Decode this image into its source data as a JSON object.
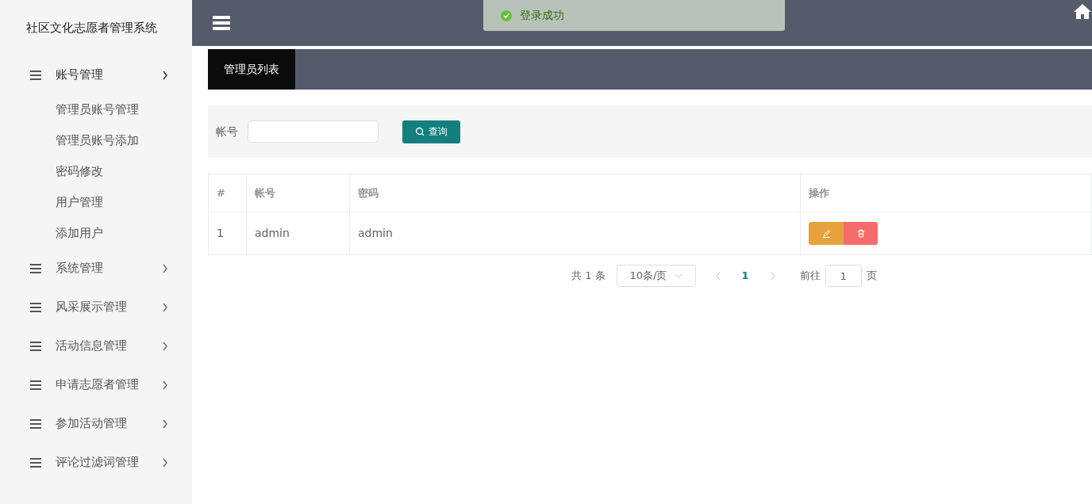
{
  "sidebar": {
    "title": "社区文化志愿者管理系统",
    "menus": [
      {
        "label": "账号管理",
        "expanded": true,
        "children": [
          {
            "label": "管理员账号管理"
          },
          {
            "label": "管理员账号添加"
          },
          {
            "label": "密码修改"
          },
          {
            "label": "用户管理"
          },
          {
            "label": "添加用户"
          }
        ]
      },
      {
        "label": "系统管理",
        "expanded": false
      },
      {
        "label": "风采展示管理",
        "expanded": false
      },
      {
        "label": "活动信息管理",
        "expanded": false
      },
      {
        "label": "申请志愿者管理",
        "expanded": false
      },
      {
        "label": "参加活动管理",
        "expanded": false
      },
      {
        "label": "评论过滤词管理",
        "expanded": false
      }
    ]
  },
  "toast": {
    "message": "登录成功"
  },
  "tabs": [
    {
      "label": "管理员列表",
      "selected": true
    }
  ],
  "search": {
    "label": "帐号",
    "button": "查询"
  },
  "table": {
    "columns": [
      "#",
      "帐号",
      "密码",
      "操作"
    ],
    "rows": [
      {
        "cells": [
          "1",
          "admin",
          "admin"
        ]
      }
    ]
  },
  "pagination": {
    "total": "共 1 条",
    "page_size": "10条/页",
    "pages": [
      {
        "label": "1",
        "selected": true
      }
    ],
    "goto_label": "前往",
    "goto_value": "1",
    "goto_suffix": "页"
  }
}
